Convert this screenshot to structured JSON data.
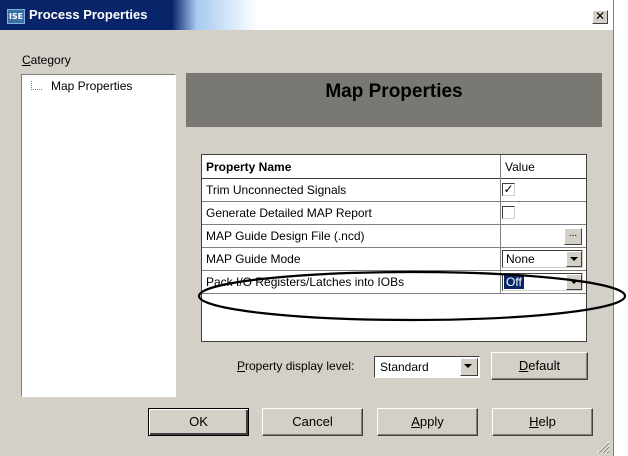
{
  "window": {
    "title": "Process Properties",
    "icon_text": "ISE",
    "close_glyph": "✕"
  },
  "category": {
    "label_prefix": "C",
    "label_rest": "ategory",
    "items": [
      "Map Properties"
    ]
  },
  "header": {
    "title": "Map Properties",
    "background_color": "#7a7873"
  },
  "grid": {
    "columns": [
      "Property Name",
      "Value"
    ],
    "rows": [
      {
        "name": "Trim Unconnected Signals",
        "value_type": "checkbox",
        "checked": true
      },
      {
        "name": "Generate Detailed MAP Report",
        "value_type": "checkbox",
        "checked": false
      },
      {
        "name": "MAP Guide Design File (.ncd)",
        "value_type": "file",
        "button_text": "..."
      },
      {
        "name": "MAP Guide Mode",
        "value_type": "select",
        "value": "None"
      },
      {
        "name": "Pack I/O Registers/Latches into IOBs",
        "value_type": "select",
        "value": "Off",
        "highlighted": true
      }
    ]
  },
  "display_level": {
    "label_prefix": "P",
    "label_rest": "roperty display level:",
    "value": "Standard"
  },
  "buttons": {
    "default": {
      "prefix": "D",
      "rest": "efault"
    },
    "ok": "OK",
    "cancel": "Cancel",
    "apply": {
      "prefix": "A",
      "rest": "pply"
    },
    "help": {
      "prefix": "H",
      "rest": "elp"
    }
  },
  "annotation": {
    "shape": "ellipse",
    "stroke_color": "#000000"
  },
  "colors": {
    "dialog_face": "#d4d0c8",
    "title_active": "#0a246a",
    "selection": "#0a246a"
  }
}
